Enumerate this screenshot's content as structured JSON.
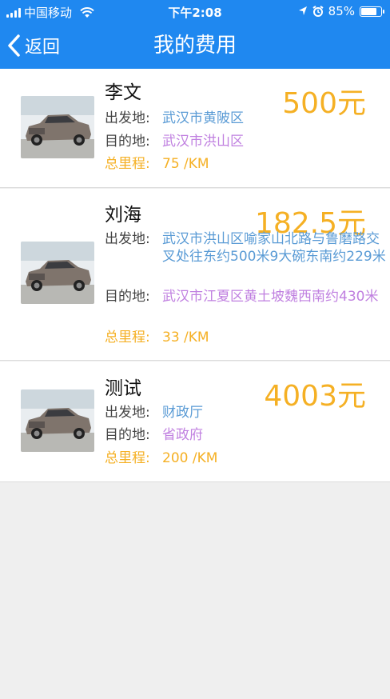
{
  "status_bar": {
    "carrier": "中国移动",
    "time": "下午2:08",
    "battery": "85%",
    "battery_level": 0.85
  },
  "nav": {
    "back_label": "返回",
    "title": "我的费用"
  },
  "labels": {
    "from": "出发地:",
    "to": "目的地:",
    "distance": "总里程:"
  },
  "records": [
    {
      "name": "李文",
      "price": "500元",
      "from": "武汉市黄陂区",
      "to": "武汉市洪山区",
      "distance": "75 /KM"
    },
    {
      "name": "刘海",
      "price": "182.5元",
      "from": "武汉市洪山区喻家山北路与鲁磨路交叉处往东约500米9大碗东南约229米",
      "to": "武汉市江夏区黄土坡魏西南约430米",
      "distance": "33 /KM"
    },
    {
      "name": "测试",
      "price": "4003元",
      "from": "财政厅",
      "to": "省政府",
      "distance": "200 /KM"
    }
  ],
  "colors": {
    "nav_bg": "#1f88f0",
    "price": "#f5b024",
    "from_text": "#5a9bd5",
    "to_text": "#c080e0",
    "page_bg": "#efefef"
  }
}
